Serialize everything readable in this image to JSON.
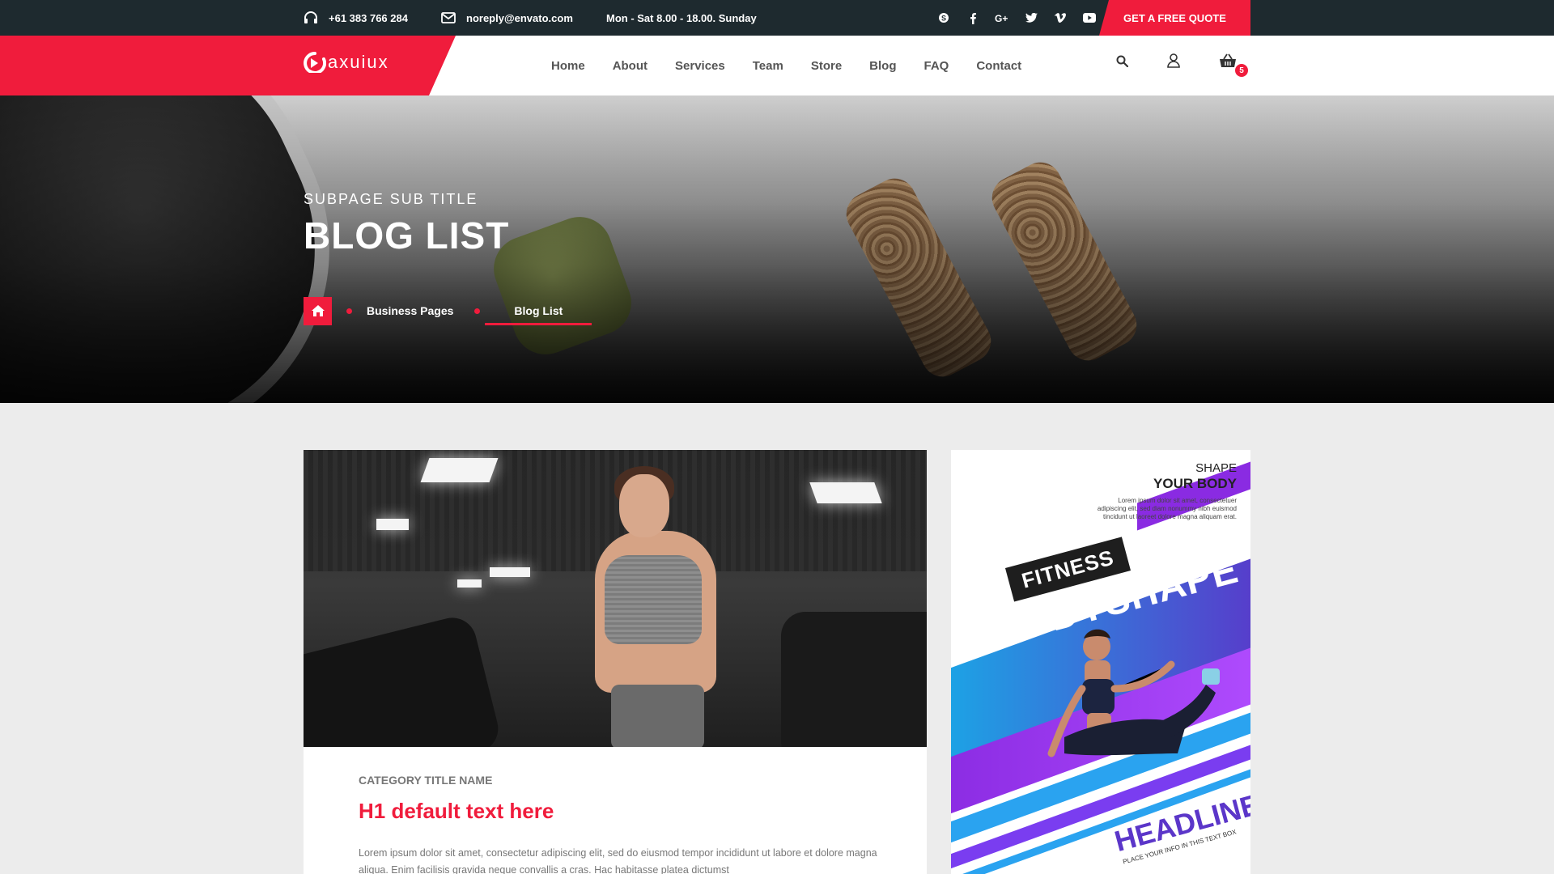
{
  "colors": {
    "accent": "#f01c3c",
    "topbar": "#1e2a2f",
    "background": "#ececec"
  },
  "topbar": {
    "phone": "+61 383 766 284",
    "email": "noreply@envato.com",
    "hours": "Mon - Sat 8.00 - 18.00. Sunday",
    "social_icons": [
      "skype-icon",
      "facebook-icon",
      "google-plus-icon",
      "twitter-icon",
      "vimeo-icon",
      "youtube-icon"
    ],
    "quote_button": "GET A FREE QUOTE"
  },
  "nav": {
    "logo": "axuiux",
    "items": [
      "Home",
      "About",
      "Services",
      "Team",
      "Store",
      "Blog",
      "FAQ",
      "Contact"
    ],
    "cart_count": "5"
  },
  "hero": {
    "subtitle": "SUBPAGE SUB TITLE",
    "title": "BLOG LIST",
    "breadcrumb": [
      "Business Pages",
      "Blog List"
    ]
  },
  "post": {
    "category": "CATEGORY TITLE NAME",
    "title": "H1 default text here",
    "excerpt": "Lorem ipsum dolor sit amet, consectetur adipiscing elit, sed do eiusmod tempor incididunt ut labore et dolore magna aliqua. Enim facilisis gravida neque convallis a cras. Hac habitasse platea dictumst"
  },
  "ad": {
    "shape": "SHAPE",
    "your_body": "YOUR BODY",
    "blurb": "Lorem ipsum dolor sit amet, consectetuer adipiscing elit, sed diam nonummy nibh euismod tincidunt ut laoreet dolore magna aliquam erat.",
    "fitness": "FITNESS",
    "bodyshape": "BODYSHAPE",
    "headline": "HEADLINE",
    "place_info": "PLACE YOUR INFO IN THIS TEXT BOX"
  }
}
